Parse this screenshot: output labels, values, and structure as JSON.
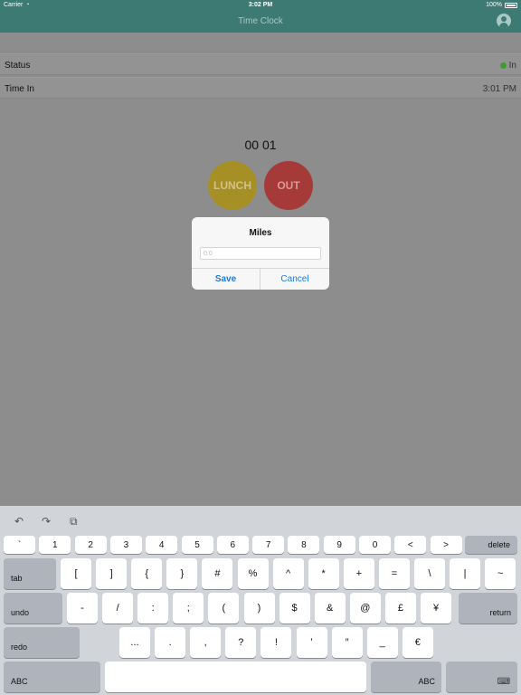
{
  "status_bar": {
    "carrier": "Carrier",
    "time": "3:02 PM",
    "battery": "100%"
  },
  "nav": {
    "title": "Time Clock",
    "profile_icon": "person-circle-icon"
  },
  "rows": [
    {
      "label": "Status",
      "value": "In",
      "indicator_color": "#3f9a2f"
    },
    {
      "label": "Time In",
      "value": "3:01 PM"
    }
  ],
  "timer": {
    "hours": "00",
    "minutes": "01"
  },
  "buttons": {
    "lunch": "LUNCH",
    "out": "OUT"
  },
  "dialog": {
    "title": "Miles",
    "input_placeholder": "0.0",
    "input_value": "",
    "save": "Save",
    "cancel": "Cancel"
  },
  "keyboard": {
    "toolbar_icons": [
      "undo-icon",
      "redo-icon",
      "paste-icon"
    ],
    "row1": [
      "`",
      "1",
      "2",
      "3",
      "4",
      "5",
      "6",
      "7",
      "8",
      "9",
      "0",
      "<",
      ">"
    ],
    "row1_func": "delete",
    "row2_func": "tab",
    "row2": [
      "[",
      "]",
      "{",
      "}",
      "#",
      "%",
      "^",
      "*",
      "+",
      "=",
      "\\",
      "|",
      "~"
    ],
    "row3_func": "undo",
    "row3": [
      "-",
      "/",
      ":",
      ";",
      "(",
      ")",
      "$",
      "&",
      "@",
      "£",
      "¥"
    ],
    "row3_func_right": "return",
    "row4_func": "redo",
    "row4": [
      "...",
      ".",
      ",",
      "?",
      "!",
      "’",
      "″",
      "_",
      "€"
    ],
    "row5_left": "ABC",
    "row5_right": "ABC",
    "colors": {
      "accent": "#1c7be0",
      "nav": "#3d7a73",
      "lunch": "#a69025",
      "out": "#a63a38"
    }
  }
}
